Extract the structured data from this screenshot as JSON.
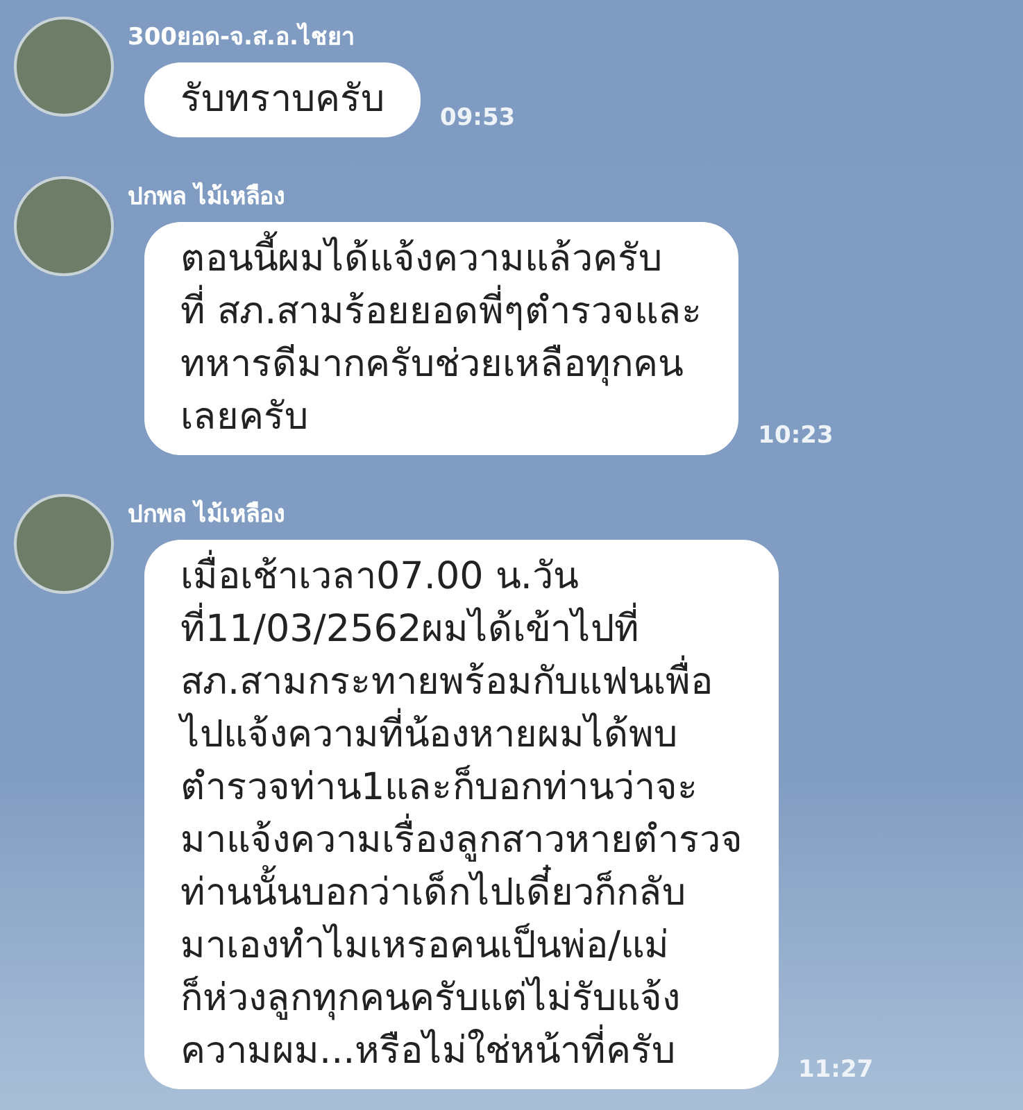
{
  "messages": [
    {
      "sender": "300ยอด-จ.ส.อ.ไชยา",
      "lines": [
        "รับทราบครับ"
      ],
      "time": "09:53"
    },
    {
      "sender": "ปกพล ไม้เหลือง",
      "lines": [
        "ตอนนี้ผมได้แจ้งความแล้วครับ",
        "ที่ สภ.สามร้อยยอดพี่ๆตำรวจและ",
        "ทหารดีมากครับช่วยเหลือทุกคน",
        "เลยครับ"
      ],
      "time": "10:23"
    },
    {
      "sender": "ปกพล ไม้เหลือง",
      "lines": [
        "เมื่อเช้าเวลา07.00 น.วัน",
        "ที่11/03/2562ผมได้เข้าไปที่",
        "สภ.สามกระทายพร้อมกับแฟนเพื่อ",
        "ไปแจ้งความที่น้องหายผมได้พบ",
        "ตำรวจท่าน1และก็บอกท่านว่าจะ",
        "มาแจ้งความเรื่องลูกสาวหายตำรวจ",
        "ท่านนั้นบอกว่าเด็กไปเดี๋ยวก็กลับ",
        "มาเองทำไมเหรอคนเป็นพ่อ/แม่",
        "ก็ห่วงลูกทุกคนครับแต่ไม่รับแจ้ง",
        "ความผม...หรือไม่ใช่หน้าที่ครับ"
      ],
      "time": "11:27"
    }
  ]
}
